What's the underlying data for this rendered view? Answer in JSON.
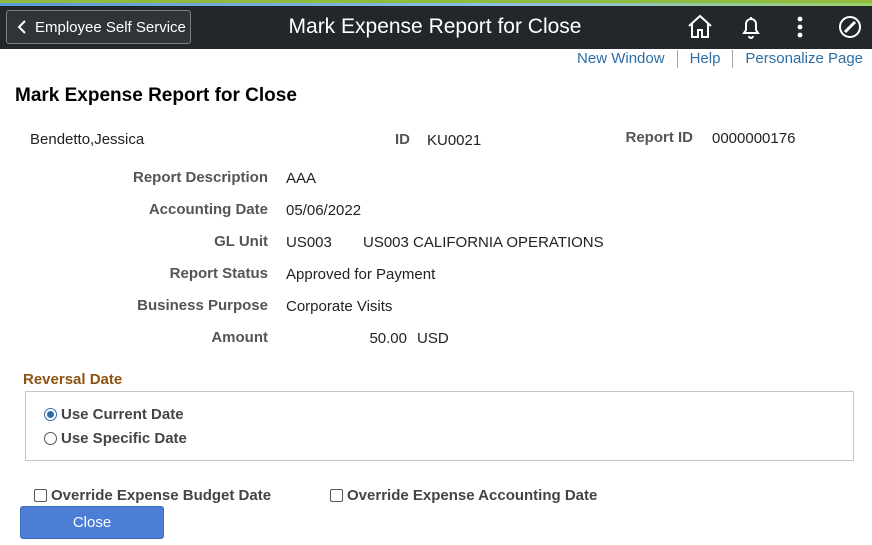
{
  "header": {
    "back_label": "Employee Self Service",
    "title": "Mark Expense Report for Close",
    "icons": [
      "home-icon",
      "bell-icon",
      "more-options-icon",
      "navbar-compass-icon"
    ]
  },
  "utility_links": {
    "new_window": "New Window",
    "help": "Help",
    "personalize": "Personalize Page"
  },
  "page": {
    "title": "Mark Expense Report for Close"
  },
  "employee": {
    "name": "Bendetto,Jessica",
    "id_label": "ID",
    "id_value": "KU0021",
    "report_id_label": "Report ID",
    "report_id_value": "0000000176"
  },
  "details": {
    "report_description_label": "Report Description",
    "report_description_value": "AAA",
    "accounting_date_label": "Accounting Date",
    "accounting_date_value": "05/06/2022",
    "gl_unit_label": "GL Unit",
    "gl_unit_code": "US003",
    "gl_unit_name": "US003 CALIFORNIA OPERATIONS",
    "report_status_label": "Report Status",
    "report_status_value": "Approved for Payment",
    "business_purpose_label": "Business Purpose",
    "business_purpose_value": "Corporate Visits",
    "amount_label": "Amount",
    "amount_value": "50.00",
    "amount_currency": "USD"
  },
  "reversal": {
    "title": "Reversal Date",
    "option_current": "Use Current Date",
    "option_specific": "Use Specific Date",
    "selected": "current"
  },
  "overrides": {
    "budget_date": "Override Expense Budget Date",
    "accounting_date": "Override Expense Accounting Date"
  },
  "actions": {
    "close": "Close"
  },
  "colors": {
    "header_bg": "#23272c",
    "link": "#2d6ea6",
    "section_title": "#8c5312",
    "primary_button": "#4d7ed6"
  }
}
